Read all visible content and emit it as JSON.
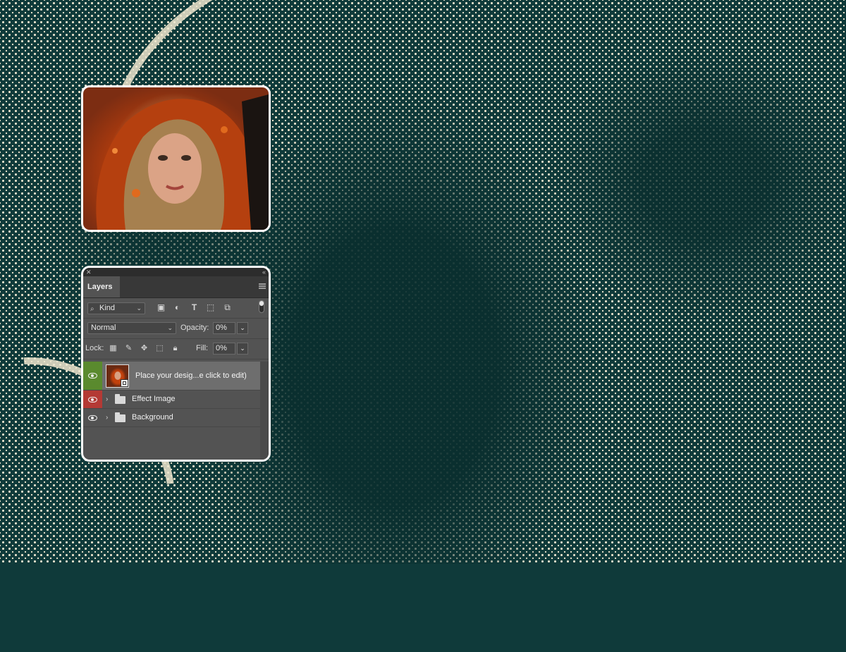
{
  "background": {
    "colors": {
      "base": "#0f3a3a",
      "halftone": "#efe6cf"
    }
  },
  "preview": {
    "icon": "portrait-photo"
  },
  "layers_panel": {
    "tab_label": "Layers",
    "kind_filter": "Kind",
    "filter_icons": [
      "image-filter-icon",
      "adjustment-filter-icon",
      "type-filter-icon",
      "shape-filter-icon",
      "smart-object-filter-icon"
    ],
    "blend_mode": "Normal",
    "opacity_label": "Opacity:",
    "opacity_value": "0%",
    "lock_label": "Lock:",
    "lock_icons": [
      "lock-transparent-icon",
      "lock-image-icon",
      "lock-position-icon",
      "lock-artboard-icon",
      "lock-all-icon"
    ],
    "fill_label": "Fill:",
    "fill_value": "0%",
    "layers": [
      {
        "name": "Place your desig...e click to edit)",
        "type": "smart-object",
        "visible": true,
        "color_tag": "#5a8a2e",
        "selected": true
      },
      {
        "name": "Effect Image",
        "type": "group",
        "visible": true,
        "color_tag": "#b43a35",
        "selected": false
      },
      {
        "name": "Background",
        "type": "group",
        "visible": true,
        "color_tag": "none",
        "selected": false
      }
    ]
  }
}
